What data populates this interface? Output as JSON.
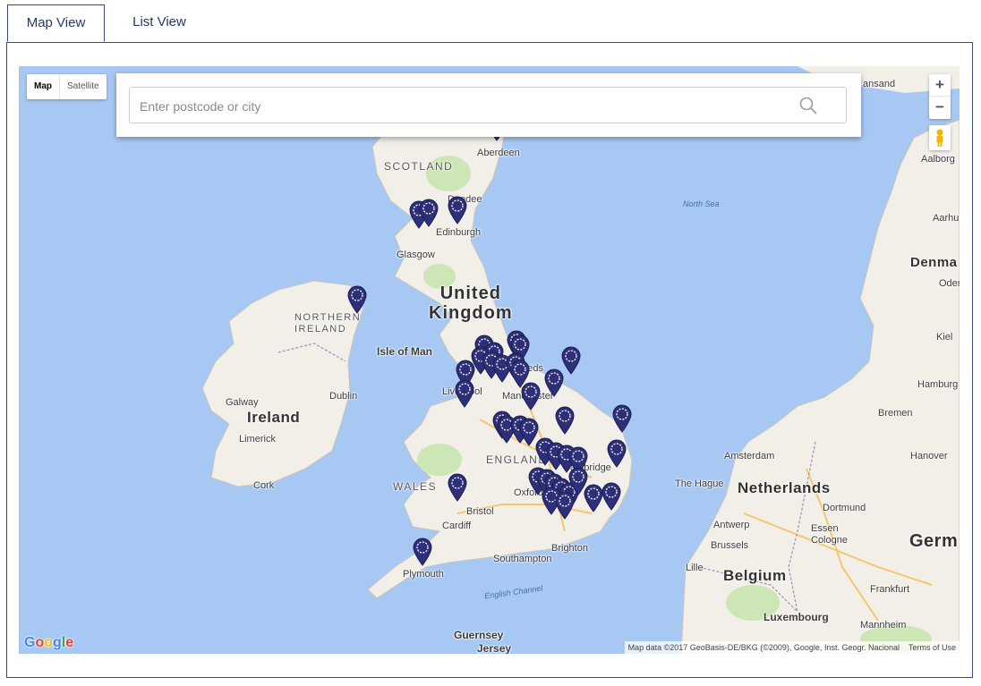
{
  "tabs": [
    {
      "label": "Map View",
      "active": true
    },
    {
      "label": "List View",
      "active": false
    }
  ],
  "map": {
    "type_control": {
      "map_label": "Map",
      "satellite_label": "Satellite",
      "selected": "Map"
    },
    "search": {
      "placeholder": "Enter postcode or city",
      "value": ""
    },
    "zoom": {
      "in_label": "+",
      "out_label": "−"
    },
    "labels": {
      "scotland": "SCOTLAND",
      "united_kingdom": "United\nKingdom",
      "northern_ireland": "NORTHERN\nIRELAND",
      "ireland": "Ireland",
      "wales": "WALES",
      "england": "ENGLAND",
      "isle_of_man": "Isle of Man",
      "aberdeen": "Aberdeen",
      "dundee": "Dundee",
      "edinburgh": "Edinburgh",
      "glasgow": "Glasgow",
      "dublin": "Dublin",
      "galway": "Galway",
      "limerick": "Limerick",
      "cork": "Cork",
      "liverpool": "Liverpool",
      "manchester": "Manchester",
      "leeds": "Leeds",
      "cambridge": "Cambridge",
      "oxford": "Oxford",
      "bristol": "Bristol",
      "cardiff": "Cardiff",
      "plymouth": "Plymouth",
      "brighton": "Brighton",
      "southampton": "Southampton",
      "guernsey": "Guernsey",
      "jersey": "Jersey",
      "english_channel": "English Channel",
      "north_sea": "North Sea",
      "netherlands": "Netherlands",
      "belgium": "Belgium",
      "germany": "Germ",
      "denmark": "Denma",
      "amsterdam": "Amsterdam",
      "the_hague": "The Hague",
      "dortmund": "Dortmund",
      "essen": "Essen",
      "cologne": "Cologne",
      "antwerp": "Antwerp",
      "brussels": "Brussels",
      "lille": "Lille",
      "luxembourg": "Luxembourg",
      "frankfurt": "Frankfurt",
      "bremen": "Bremen",
      "hamburg": "Hamburg",
      "hanover": "Hanover",
      "aalborg": "Aalborg",
      "aarhus": "Aarhus",
      "odense": "Odense",
      "kiel": "Kiel",
      "mannheim": "Mannheim",
      "bergen_partial": "ansand"
    },
    "logo": "Google",
    "attribution": "Map data ©2017 GeoBasis-DE/BKG (©2009), Google, Inst. Geogr. Nacional",
    "terms": "Terms of Use",
    "colors": {
      "water": "#a8c8f4",
      "land": "#f1efe8",
      "park": "#cde6b5",
      "pin": "#2d2f78"
    }
  }
}
